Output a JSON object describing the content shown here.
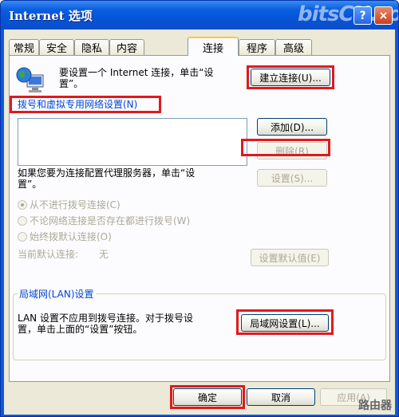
{
  "window": {
    "title": "Internet 选项",
    "watermark": "bitsCN.com",
    "help_label": "?",
    "close_label": "×"
  },
  "tabs": [
    {
      "label": "常规"
    },
    {
      "label": "安全"
    },
    {
      "label": "隐私"
    },
    {
      "label": "内容"
    },
    {
      "label": "连接"
    },
    {
      "label": "程序"
    },
    {
      "label": "高级"
    }
  ],
  "setup": {
    "text_line1": "要设置一个 Internet 连接，单击“设",
    "text_line2": "置”。",
    "button": "建立连接(U)..."
  },
  "dialup": {
    "heading": "拨号和虚拟专用网络设置(N)",
    "add_button": "添加(D)...",
    "delete_button": "删除(R)",
    "proxy_text_line1": "如果您要为连接配置代理服务器，单击“设",
    "proxy_text_line2": "置”。",
    "settings_button": "设置(S)...",
    "radios": [
      {
        "label": "从不进行拨号连接(C)",
        "checked": true
      },
      {
        "label": "不论网络连接是否存在都进行拨号(W)",
        "checked": false
      },
      {
        "label": "始终拨默认连接(O)",
        "checked": false
      }
    ],
    "default_label": "当前默认连接:",
    "default_value": "无",
    "set_default_button": "设置默认值(E)"
  },
  "lan": {
    "group_title": "局域网(LAN)设置",
    "text_line1": "LAN 设置不应用到拨号连接。对于拨号设",
    "text_line2": "置，单击上面的“设置”按钮。",
    "button": "局域网设置(L)..."
  },
  "footer": {
    "ok": "确定",
    "cancel": "取消",
    "apply": "应用(A)",
    "brand": "路由器"
  },
  "colors": {
    "highlight": "#e0191e",
    "titlebar": "#0654d8",
    "group_title": "#0046d5"
  }
}
